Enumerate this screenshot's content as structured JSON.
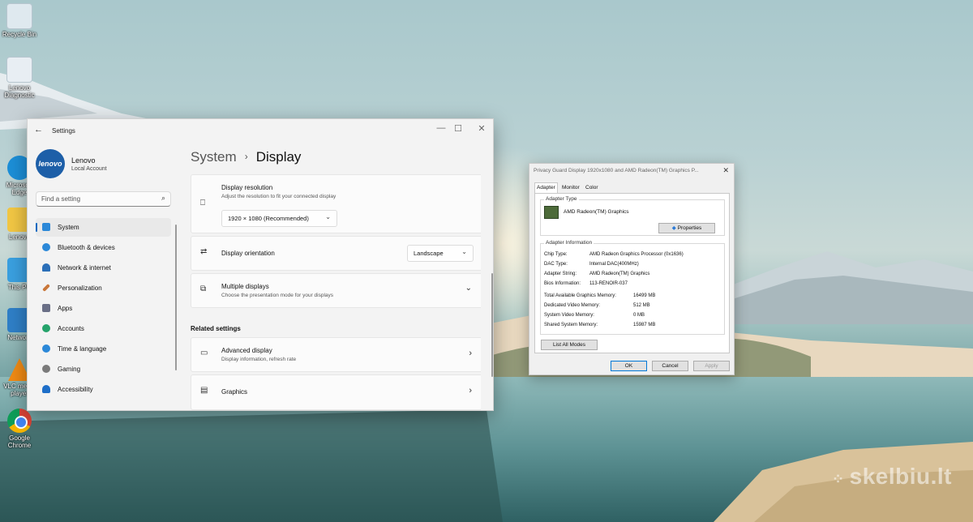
{
  "desktop": {
    "icons": [
      {
        "label": "Recycle Bin",
        "icon": "recycle-bin-icon",
        "color": "#dfe9ef"
      },
      {
        "label": "Lenovo Diagnostic",
        "icon": "lenovo-diagnostics-icon",
        "color": "#e8eef3"
      },
      {
        "label": "Microsoft Edge",
        "icon": "edge-icon",
        "color": "#1c8fd8"
      },
      {
        "label": "Lenovo",
        "icon": "folder-icon",
        "color": "#f2c744"
      },
      {
        "label": "This PC",
        "icon": "this-pc-icon",
        "color": "#3aa0e0"
      },
      {
        "label": "Network",
        "icon": "network-icon",
        "color": "#2f7fc7"
      },
      {
        "label": "VLC media player",
        "icon": "vlc-icon",
        "color": "#f08a14"
      },
      {
        "label": "Google Chrome",
        "icon": "chrome-icon",
        "color": "#db4437"
      }
    ],
    "watermark": "skelbiu.lt"
  },
  "settings": {
    "title": "Settings",
    "back_icon": "←",
    "controls": {
      "minimize": "—",
      "maximize": "☐",
      "close": "✕"
    },
    "profile": {
      "avatar_text": "lenovo",
      "name": "Lenovo",
      "account": "Local Account"
    },
    "search": {
      "placeholder": "Find a setting",
      "icon": "⌕"
    },
    "breadcrumb": {
      "parent": "System",
      "sep": "›",
      "current": "Display"
    },
    "nav": [
      {
        "label": "System",
        "icon": "system-icon",
        "color": "#2b88d8",
        "active": true
      },
      {
        "label": "Bluetooth & devices",
        "icon": "bluetooth-icon",
        "color": "#2b88d8"
      },
      {
        "label": "Network & internet",
        "icon": "wifi-icon",
        "color": "#2b6fb8"
      },
      {
        "label": "Personalization",
        "icon": "brush-icon",
        "color": "#c9773a"
      },
      {
        "label": "Apps",
        "icon": "apps-icon",
        "color": "#6a6f86"
      },
      {
        "label": "Accounts",
        "icon": "accounts-icon",
        "color": "#25a36b"
      },
      {
        "label": "Time & language",
        "icon": "globe-icon",
        "color": "#2b88d8"
      },
      {
        "label": "Gaming",
        "icon": "gaming-icon",
        "color": "#7a7a7a"
      },
      {
        "label": "Accessibility",
        "icon": "accessibility-icon",
        "color": "#1e6ec8"
      }
    ],
    "display_resolution": {
      "title": "Display resolution",
      "subtitle": "Adjust the resolution to fit your connected display",
      "value": "1920 × 1080 (Recommended)",
      "icon_glyph": "⎕"
    },
    "display_orientation": {
      "title": "Display orientation",
      "value": "Landscape",
      "icon_glyph": "⇄"
    },
    "multiple_displays": {
      "title": "Multiple displays",
      "subtitle": "Choose the presentation mode for your displays",
      "icon_glyph": "⧉"
    },
    "related_settings": "Related settings",
    "advanced_display": {
      "title": "Advanced display",
      "subtitle": "Display information, refresh rate",
      "icon_glyph": "▭"
    },
    "graphics": {
      "title": "Graphics",
      "icon_glyph": "▤"
    },
    "chevron_down": "⌄",
    "chevron_right": "›"
  },
  "dialog": {
    "title": "Privacy Guard Display 1920x1080 and AMD Radeon(TM) Graphics P...",
    "close": "✕",
    "tabs": [
      "Adapter",
      "Monitor",
      "Color Management"
    ],
    "adapter_type": {
      "legend": "Adapter Type",
      "name": "AMD Radeon(TM) Graphics",
      "properties_button": "Properties"
    },
    "adapter_info": {
      "legend": "Adapter Information",
      "chip_type": {
        "label": "Chip Type:",
        "value": "AMD Radeon Graphics Processor (0x1636)"
      },
      "dac_type": {
        "label": "DAC Type:",
        "value": "Internal DAC(400MHz)"
      },
      "adapter_string": {
        "label": "Adapter String:",
        "value": "AMD Radeon(TM) Graphics"
      },
      "bios_info": {
        "label": "Bios Information:",
        "value": "113-RENOIR-037"
      }
    },
    "memory": {
      "total": {
        "label": "Total Available Graphics Memory:",
        "value": "16499 MB"
      },
      "dedicated": {
        "label": "Dedicated Video Memory:",
        "value": "512 MB"
      },
      "system_video": {
        "label": "System Video Memory:",
        "value": "0 MB"
      },
      "shared": {
        "label": "Shared System Memory:",
        "value": "15987 MB"
      }
    },
    "list_all_modes": "List All Modes",
    "buttons": {
      "ok": "OK",
      "cancel": "Cancel",
      "apply": "Apply"
    }
  }
}
